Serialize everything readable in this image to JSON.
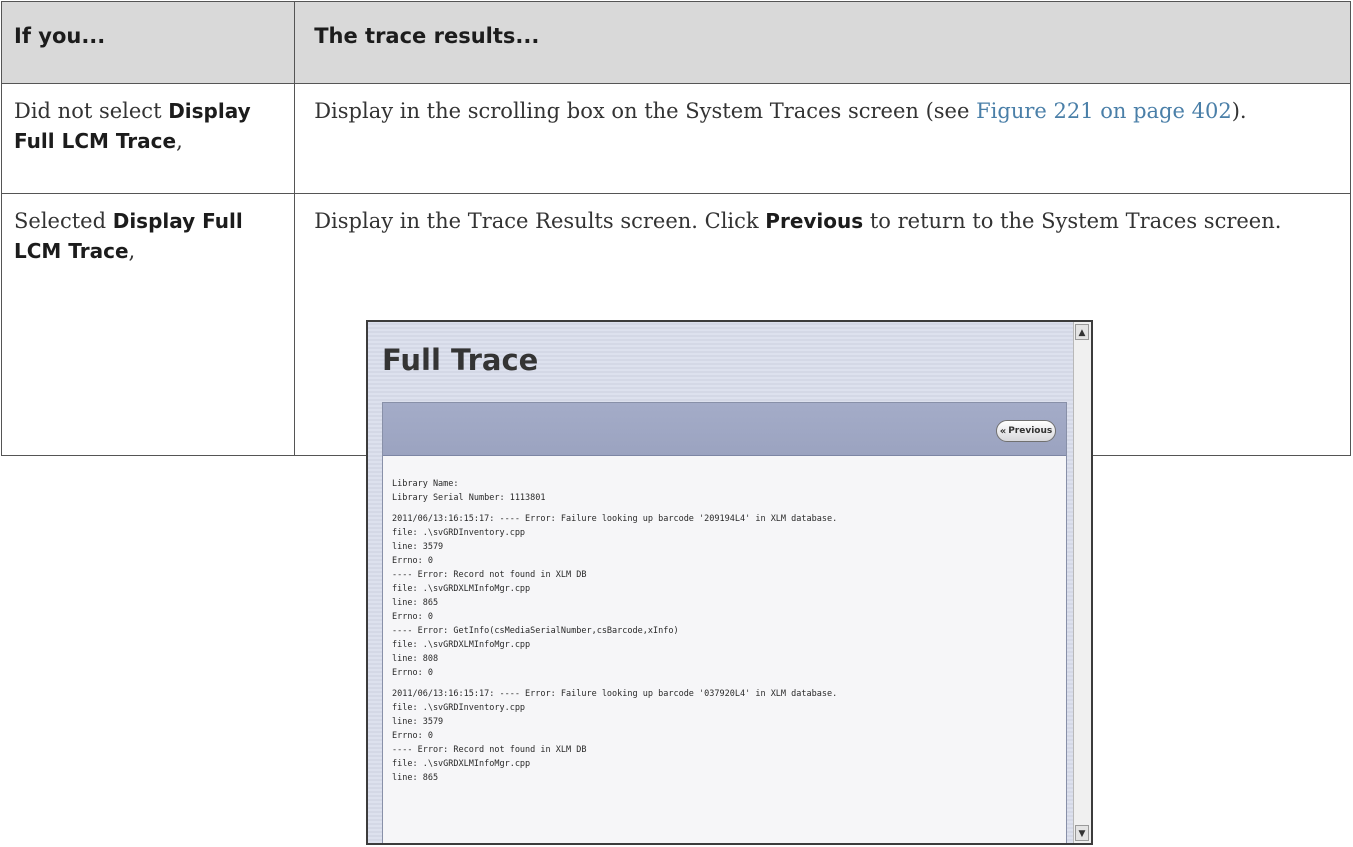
{
  "table": {
    "headers": [
      "If you...",
      "The trace results..."
    ],
    "row1": {
      "condition_prefix": "Did not select ",
      "condition_bold": "Display Full LCM Trace",
      "condition_suffix": ",",
      "result_text": "Display in the scrolling box on the System Traces screen (see ",
      "result_link": "Figure 221 on page 402",
      "result_suffix": ")."
    },
    "row2": {
      "condition_prefix": "Selected ",
      "condition_bold": "Display Full LCM Trace",
      "condition_suffix": ",",
      "result_text_1": "Display in the Trace Results screen. Click ",
      "result_bold": "Previous",
      "result_text_2": " to return to the System Traces screen."
    }
  },
  "screenshot": {
    "title": "Full Trace",
    "previous_label": "Previous",
    "previous_icon": "double-chevron-left-icon",
    "trace_block_1": [
      "Library Name:",
      "Library Serial Number: 1113801"
    ],
    "trace_block_2": [
      "2011/06/13:16:15:17: ---- Error: Failure looking up barcode '209194L4' in XLM database.",
      "file: .\\svGRDInventory.cpp",
      "line: 3579",
      "Errno: 0",
      "---- Error: Record not found in XLM DB",
      "file: .\\svGRDXLMInfoMgr.cpp",
      "line: 865",
      "Errno: 0",
      "---- Error: GetInfo(csMediaSerialNumber,csBarcode,xInfo)",
      "file: .\\svGRDXLMInfoMgr.cpp",
      "line: 808",
      "Errno: 0"
    ],
    "trace_block_3": [
      "2011/06/13:16:15:17: ---- Error: Failure looking up barcode '037920L4' in XLM database.",
      "file: .\\svGRDInventory.cpp",
      "line: 3579",
      "Errno: 0",
      "---- Error: Record not found in XLM DB",
      "file: .\\svGRDXLMInfoMgr.cpp",
      "line: 865"
    ]
  }
}
